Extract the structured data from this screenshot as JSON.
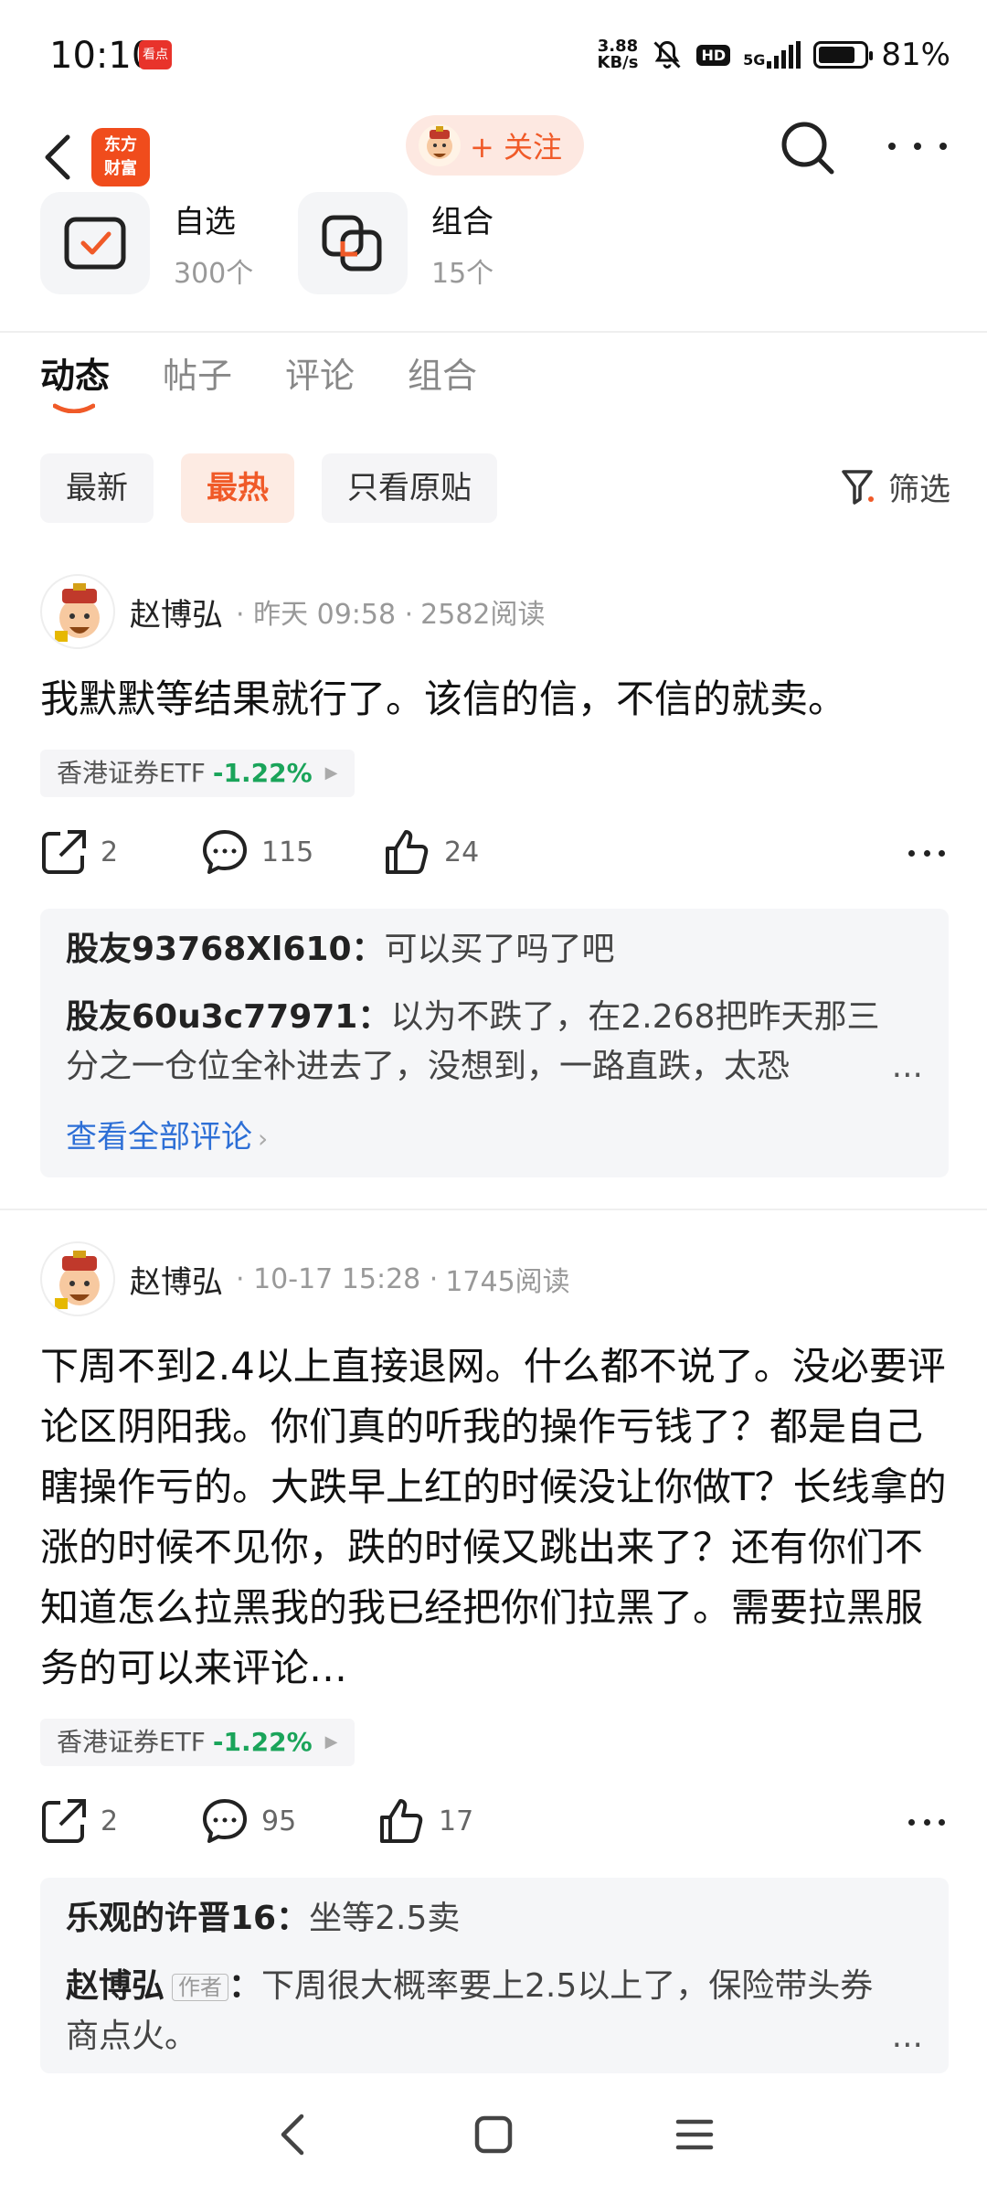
{
  "status_bar": {
    "time": "10:10",
    "app_badge": "看点",
    "net_speed_value": "3.88",
    "net_speed_unit": "KB/s",
    "hd": "HD",
    "network": "5G",
    "battery_value": 81,
    "battery": "81%"
  },
  "header": {
    "logo_line1": "东方",
    "logo_line2": "财富",
    "follow_label": "+ 关注"
  },
  "stats": {
    "watchlist": {
      "title": "自选",
      "count": "300个"
    },
    "portfolio": {
      "title": "组合",
      "count": "15个"
    }
  },
  "tabs": [
    {
      "label": "动态",
      "active": true
    },
    {
      "label": "帖子",
      "active": false
    },
    {
      "label": "评论",
      "active": false
    },
    {
      "label": "组合",
      "active": false
    }
  ],
  "filters": {
    "chips": [
      {
        "label": "最新",
        "active": false
      },
      {
        "label": "最热",
        "active": true
      },
      {
        "label": "只看原贴",
        "active": false
      }
    ],
    "filter_label": "筛选"
  },
  "posts": [
    {
      "author": "赵博弘",
      "time": "· 昨天 09:58 ·",
      "reads": "2582阅读",
      "body": "我默默等结果就行了。该信的信，不信的就卖。",
      "stock_name": "香港证券ETF",
      "stock_change": "-1.22%",
      "shares": "2",
      "comments": "115",
      "likes": "24",
      "replies": [
        {
          "author": "股友93768Xl610",
          "sep": "：",
          "text": "可以买了吗了吧"
        },
        {
          "author": "股友60u3c77971",
          "sep": "：",
          "text": "以为不跌了，在2.268把昨天那三分之一仓位全补进去了，没想到，一路直跌，太恐",
          "ellipsis": "..."
        }
      ],
      "see_all": "查看全部评论"
    },
    {
      "author": "赵博弘",
      "time": "· 10-17 15:28 ·",
      "reads": "1745阅读",
      "body": "下周不到2.4以上直接退网。什么都不说了。没必要评论区阴阳我。你们真的听我的操作亏钱了？都是自己瞎操作亏的。大跌早上红的时候没让你做T？长线拿的涨的时候不见你，跌的时候又跳出来了？还有你们不知道怎么拉黑我的我已经把你们拉黑了。需要拉黑服务的可以来评论…",
      "stock_name": "香港证券ETF",
      "stock_change": "-1.22%",
      "shares": "2",
      "comments": "95",
      "likes": "17",
      "replies": [
        {
          "author": "乐观的许晋16",
          "sep": "：",
          "text": "坐等2.5卖"
        },
        {
          "author": "赵博弘",
          "badge": "作者",
          "sep": "：",
          "text": "下周很大概率要上2.5以上了，保险带头券商点火。",
          "ellipsis": "..."
        }
      ]
    }
  ],
  "colors": {
    "accent": "#f05a28",
    "stock_down": "#1aa45a",
    "link": "#2d6fd6"
  }
}
